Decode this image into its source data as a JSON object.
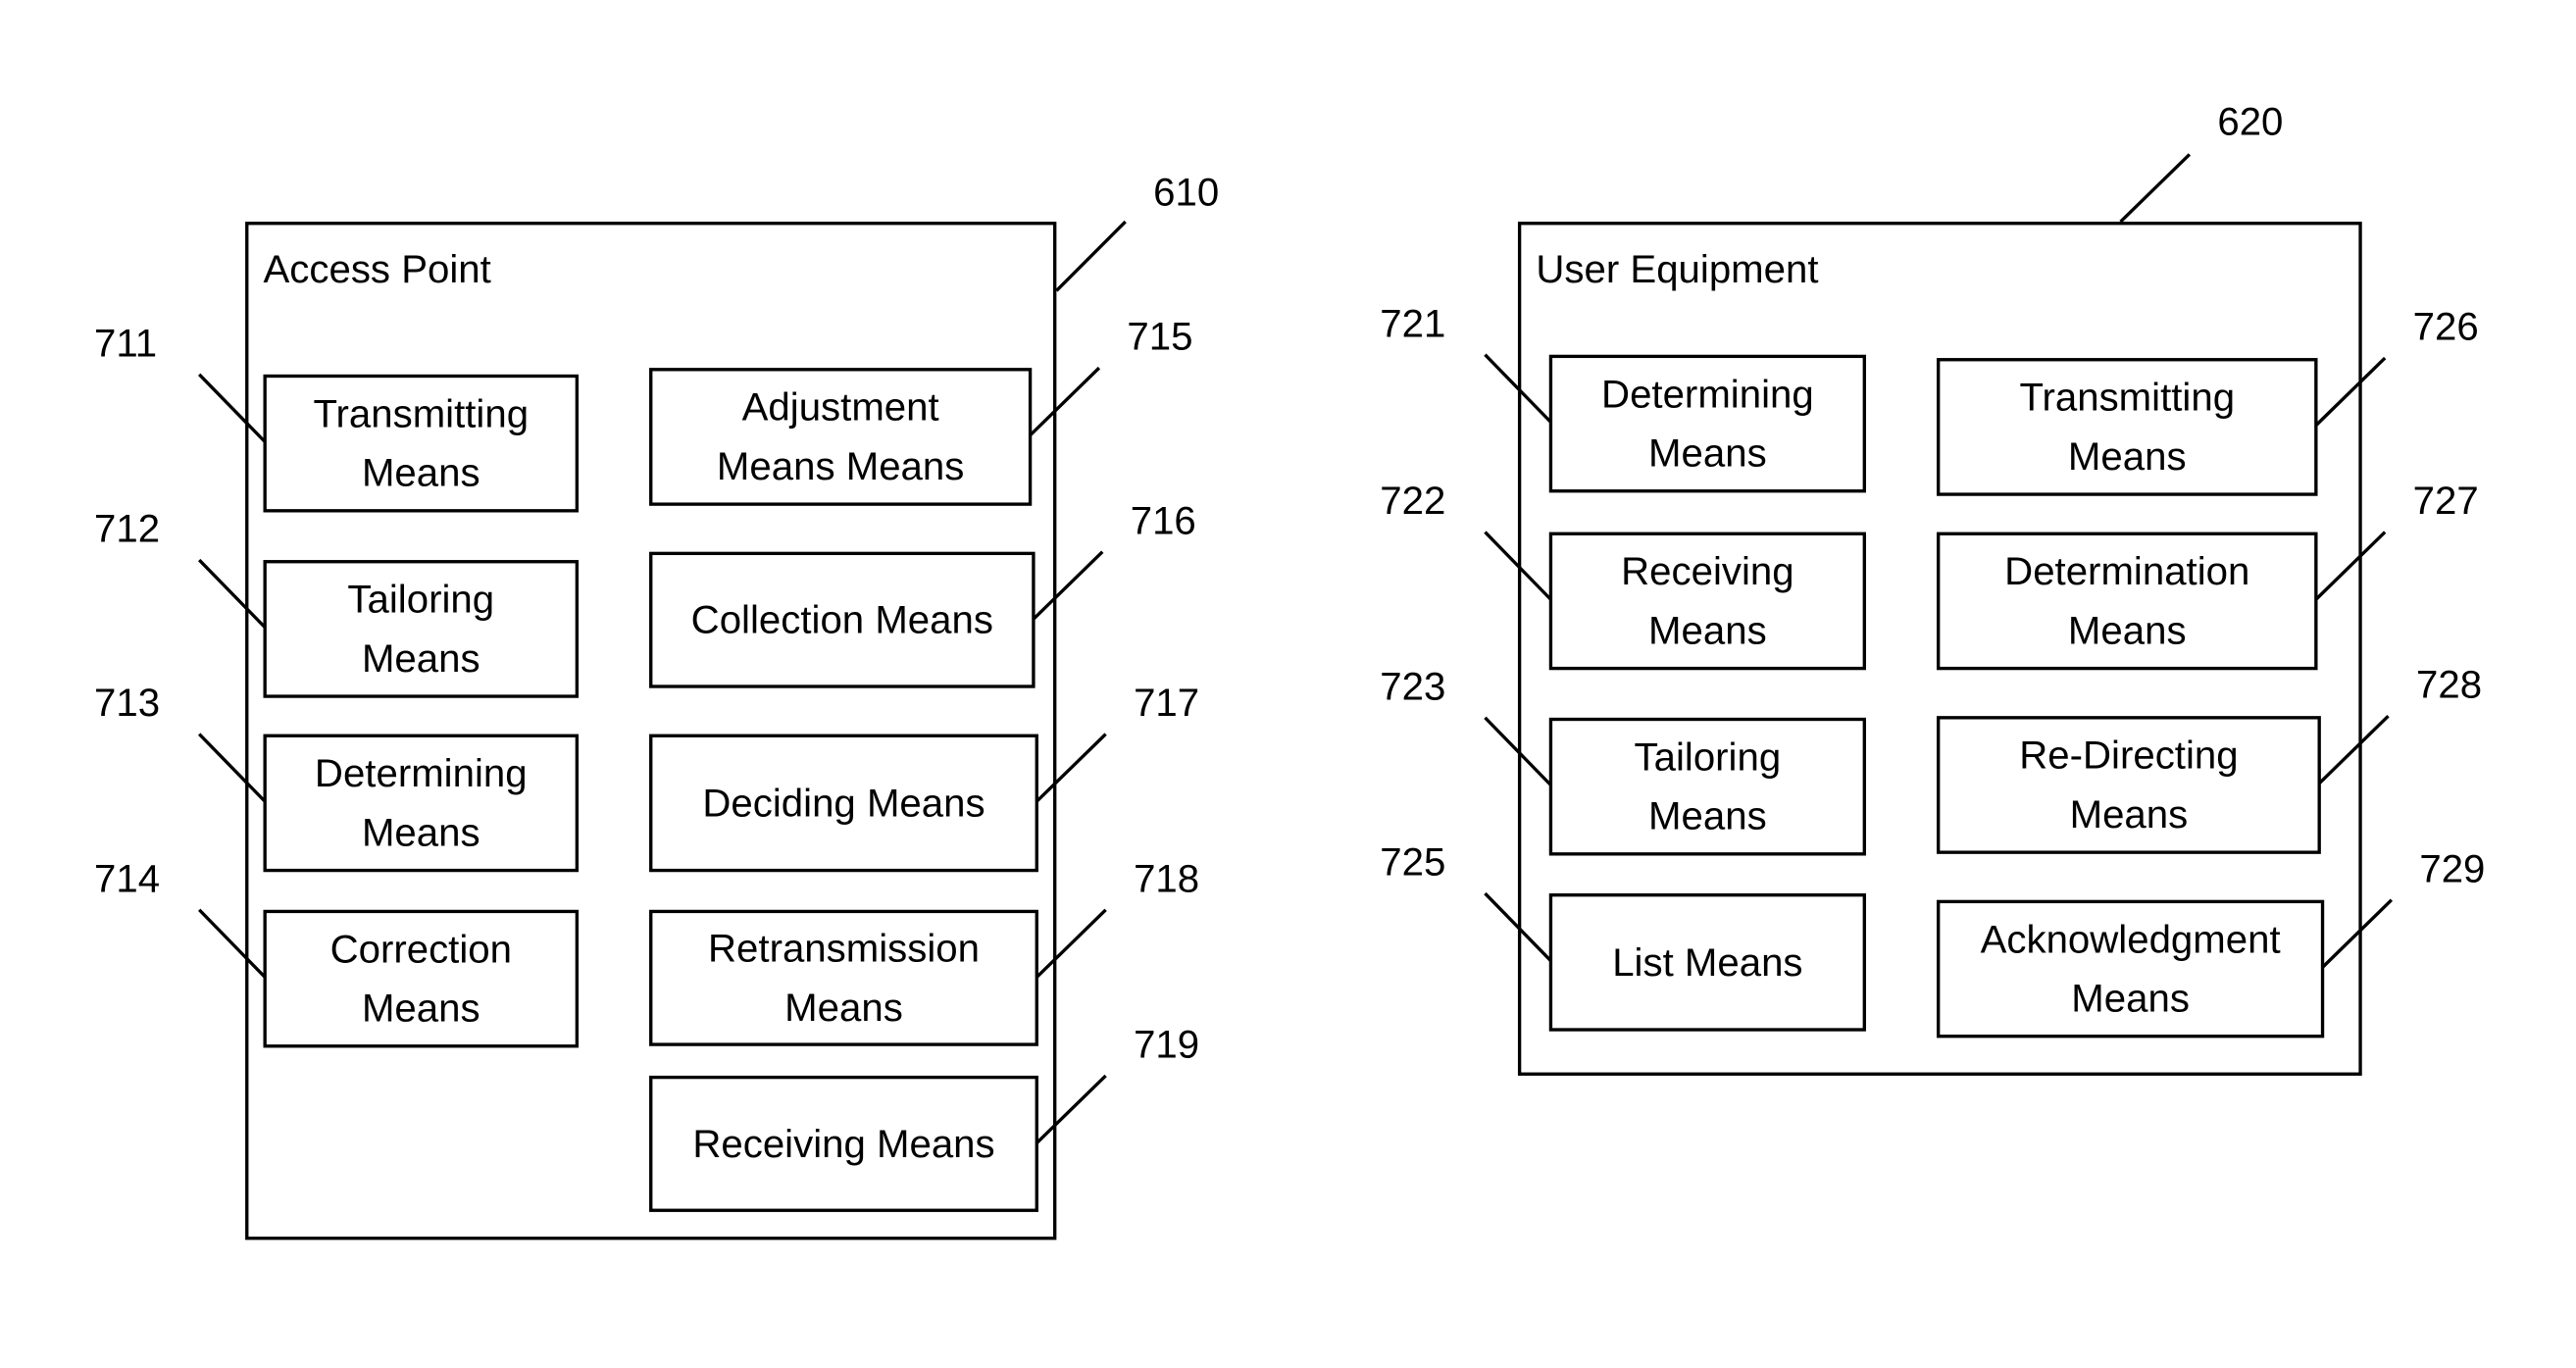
{
  "access_point": {
    "title": "Access Point",
    "ref": "610",
    "modules": [
      {
        "ref": "711",
        "lines": [
          "Transmitting",
          "Means"
        ]
      },
      {
        "ref": "712",
        "lines": [
          "Tailoring",
          "Means"
        ]
      },
      {
        "ref": "713",
        "lines": [
          "Determining",
          "Means"
        ]
      },
      {
        "ref": "714",
        "lines": [
          "Correction",
          "Means"
        ]
      },
      {
        "ref": "715",
        "lines": [
          "Adjustment",
          "Means Means"
        ]
      },
      {
        "ref": "716",
        "lines": [
          "Collection Means"
        ]
      },
      {
        "ref": "717",
        "lines": [
          "Deciding Means"
        ]
      },
      {
        "ref": "718",
        "lines": [
          "Retransmission",
          "Means"
        ]
      },
      {
        "ref": "719",
        "lines": [
          "Receiving Means"
        ]
      }
    ]
  },
  "user_equipment": {
    "title": "User Equipment",
    "ref": "620",
    "modules": [
      {
        "ref": "721",
        "lines": [
          "Determining",
          "Means"
        ]
      },
      {
        "ref": "722",
        "lines": [
          "Receiving",
          "Means"
        ]
      },
      {
        "ref": "723",
        "lines": [
          "Tailoring",
          "Means"
        ]
      },
      {
        "ref": "725",
        "lines": [
          "List Means"
        ]
      },
      {
        "ref": "726",
        "lines": [
          "Transmitting",
          "Means"
        ]
      },
      {
        "ref": "727",
        "lines": [
          "Determination",
          "Means"
        ]
      },
      {
        "ref": "728",
        "lines": [
          "Re-Directing",
          "Means"
        ]
      },
      {
        "ref": "729",
        "lines": [
          "Acknowledgment",
          "Means"
        ]
      }
    ]
  }
}
